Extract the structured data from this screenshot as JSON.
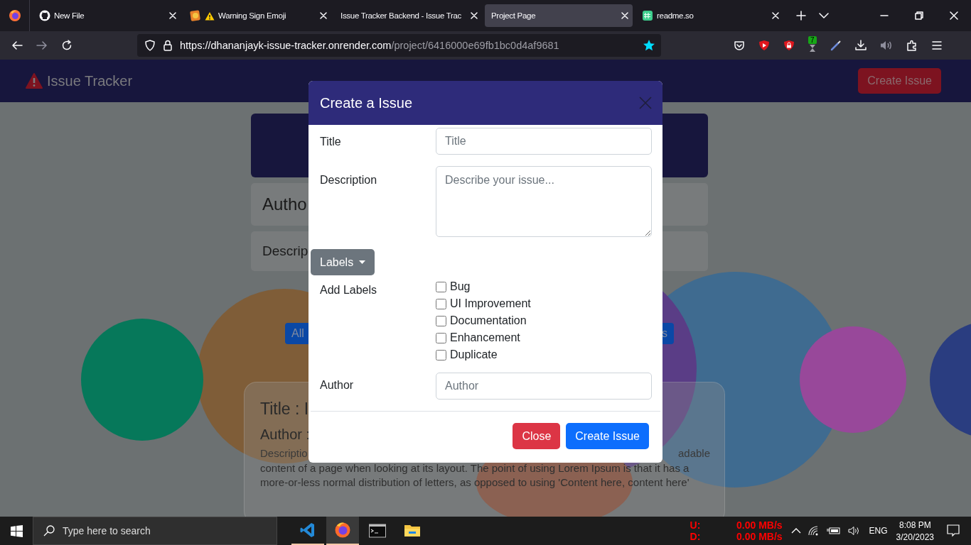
{
  "browser": {
    "tabs": [
      {
        "kind": "github",
        "title": "New File",
        "selected": false
      },
      {
        "kind": "warning",
        "title": "Warning Sign Emoji",
        "selected": false
      },
      {
        "kind": "none",
        "title": "Issue Tracker Backend - Issue Trac",
        "selected": false
      },
      {
        "kind": "none",
        "title": "Project Page",
        "selected": true
      },
      {
        "kind": "readme",
        "title": "readme.so",
        "selected": false
      }
    ],
    "url": {
      "host": "https://dhananjayk-issue-tracker.onrender.com",
      "path": "/project/6416000e69fb1bc0d4af9681"
    },
    "extension_badge": "7"
  },
  "page": {
    "navbar": {
      "brand": "Issue Tracker",
      "button": "Create Issue"
    },
    "cards": [
      "Autho",
      "Descrip"
    ],
    "filters": [
      "All",
      "s"
    ],
    "issue": {
      "title": "Title : I",
      "author": "Author :",
      "description_left": "Descriptio",
      "description_right": "adable",
      "description_rest": "content of a page when looking at its layout. The point of using Lorem Ipsum is that it has a more-or-less normal distribution of letters, as opposed to using 'Content here, content here'"
    }
  },
  "modal": {
    "title": "Create a Issue",
    "fields": [
      {
        "kind": "input",
        "label": "Title",
        "placeholder": "Title"
      },
      {
        "kind": "textarea",
        "label": "Description",
        "placeholder": "Describe your issue..."
      }
    ],
    "labels_button": "Labels",
    "add_labels": {
      "label": "Add Labels",
      "options": [
        {
          "label": "Bug",
          "checked": false
        },
        {
          "label": "UI Improvement",
          "checked": false
        },
        {
          "label": "Documentation",
          "checked": false
        },
        {
          "label": "Enhancement",
          "checked": false
        },
        {
          "label": "Duplicate",
          "checked": false
        }
      ]
    },
    "author": {
      "label": "Author",
      "placeholder": "Author"
    },
    "buttons": [
      {
        "kind": "danger",
        "label": "Close"
      },
      {
        "kind": "primary",
        "label": "Create Issue"
      }
    ]
  },
  "taskbar": {
    "search": {
      "placeholder": "Type here to search"
    },
    "apps": [
      {
        "kind": "vscode",
        "running": true,
        "selected": false
      },
      {
        "kind": "firefox",
        "running": true,
        "selected": true
      },
      {
        "kind": "terminal",
        "running": false,
        "selected": false
      },
      {
        "kind": "explorer",
        "running": false,
        "selected": false
      }
    ],
    "net": [
      {
        "label": "U:",
        "value": "0.00 MB/s"
      },
      {
        "label": "D:",
        "value": "0.00 MB/s"
      }
    ],
    "language": "ENG",
    "time": "8:08 PM",
    "date": "3/20/2023"
  }
}
